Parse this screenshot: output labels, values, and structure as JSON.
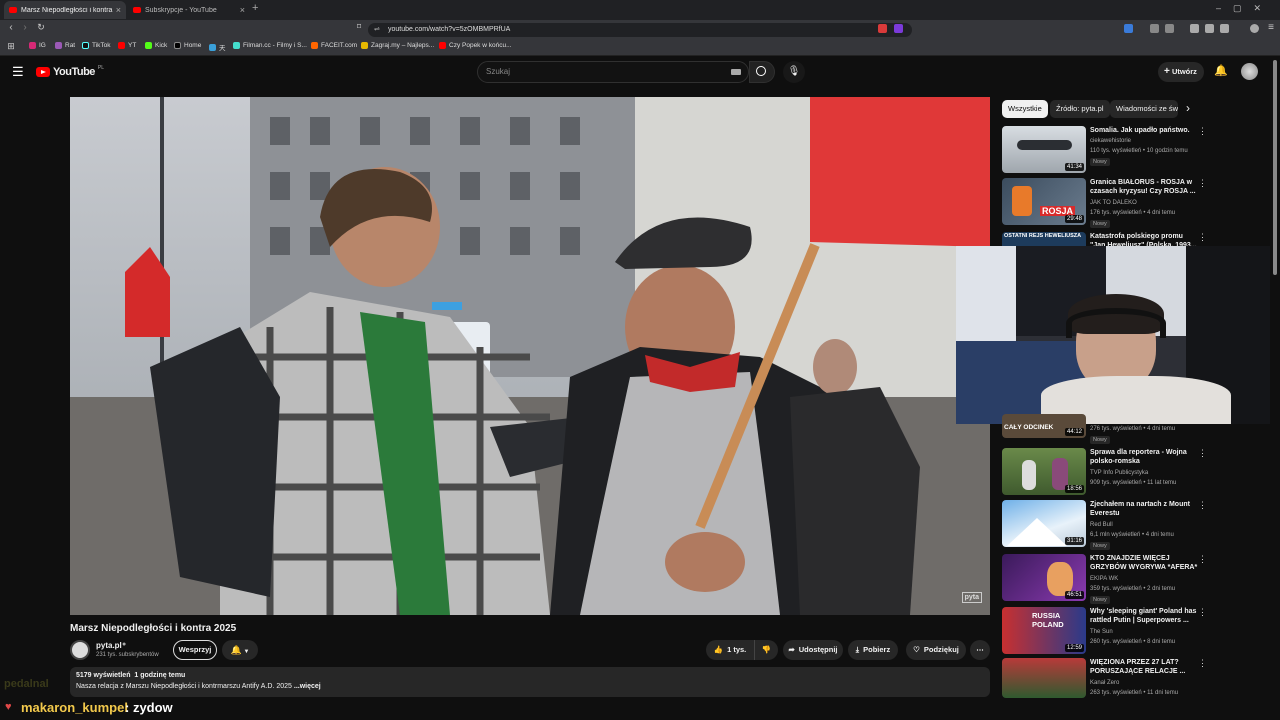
{
  "browser": {
    "tabs": [
      {
        "title": "Marsz Niepodległości i kontra"
      },
      {
        "title": "Subskrypcje - YouTube"
      }
    ],
    "new_tab": "+",
    "url": "youtube.com/watch?v=5zOMBMPRfUA",
    "bookmarks": [
      "IG",
      "Rat",
      "TikTok",
      "YT",
      "Kick",
      "Home",
      "天",
      "Filman.cc - Filmy i S...",
      "FACEIT.com",
      "Zagraj.my – Najleps...",
      "Czy Popek w końcu..."
    ]
  },
  "header": {
    "logo": "YouTube",
    "region": "PL",
    "search_placeholder": "Szukaj",
    "create_label": "Utwórz"
  },
  "video": {
    "title": "Marsz Niepodległości i kontra 2025",
    "channel": "pyta.pl",
    "subscribers": "231 tys. subskrybentów",
    "support_label": "Wesprzyj",
    "likes": "1 tys.",
    "share_label": "Udostępnij",
    "download_label": "Pobierz",
    "thanks_label": "Podziękuj",
    "views": "5179 wyświetleń",
    "age": "1 godzinę temu",
    "description": "Nasza relacja z Marszu Niepodległości i kontrmarszu Antify A.D. 2025",
    "more_label": "...więcej",
    "watermark": "pyta"
  },
  "sidebar": {
    "chips": [
      "Wszystkie",
      "Źródło: pyta.pl",
      "Wiadomości ze św"
    ],
    "videos": [
      {
        "title": "Somalia. Jak upadło państwo.",
        "channel": "ciekawehistorie",
        "meta": "110 tys. wyświetleń • 10 godzin temu",
        "badge": "Nowy",
        "duration": "41:34"
      },
      {
        "title": "Granica BIAŁORUŚ - ROSJA w czasach kryzysu! Czy ROSJA ...",
        "channel": "JAK TO DALEKO",
        "meta": "176 tys. wyświetleń • 4 dni temu",
        "badge": "Nowy",
        "duration": "29:48",
        "thumb_text": "ROSJA"
      },
      {
        "title": "Katastrofa polskiego promu \"Jan Heweliusz\" (Polska, 1993...",
        "channel": "",
        "meta": "",
        "badge": "",
        "duration": "",
        "thumb_text": "OSTATNI REJS HEWELIUSZA"
      },
      {
        "title": "",
        "channel": "",
        "meta": "276 tys. wyświetleń • 4 dni temu",
        "badge": "Nowy",
        "duration": "44:12",
        "thumb_text": "CAŁY ODCINEK"
      },
      {
        "title": "Sprawa dla reportera - Wojna polsko-romska",
        "channel": "TVP Info Publicystyka",
        "meta": "909 tys. wyświetleń • 11 lat temu",
        "badge": "",
        "duration": "18:56"
      },
      {
        "title": "Zjechałem na nartach z Mount Everestu",
        "channel": "Red Bull",
        "meta": "6,1 mln wyświetleń • 4 dni temu",
        "badge": "Nowy",
        "duration": "31:16"
      },
      {
        "title": "KTO ZNAJDZIE WIĘCEJ GRZYBÓW WYGRYWA *AFERA*",
        "channel": "EKIPA WK",
        "meta": "359 tys. wyświetleń • 2 dni temu",
        "badge": "Nowy",
        "duration": "46:51"
      },
      {
        "title": "Why 'sleeping giant' Poland has rattled Putin | Superpowers ...",
        "channel": "The Sun",
        "meta": "260 tys. wyświetleń • 8 dni temu",
        "badge": "",
        "duration": "12:59",
        "thumb_text": "RUSSIA POLAND"
      },
      {
        "title": "WIĘZIONA PRZEZ 27 LAT? PORUSZAJĄCE RELACJE ...",
        "channel": "Kanał Zero",
        "meta": "263 tys. wyświetleń • 11 dni temu",
        "badge": "",
        "duration": ""
      }
    ]
  },
  "chat": {
    "username": "makaron_kumpel",
    "message": ": zydow",
    "faded_user": "pedalnal"
  },
  "colors": {
    "accent": "#ff0000",
    "bg": "#0f0f0f",
    "chat_user": "#f2c94c"
  }
}
